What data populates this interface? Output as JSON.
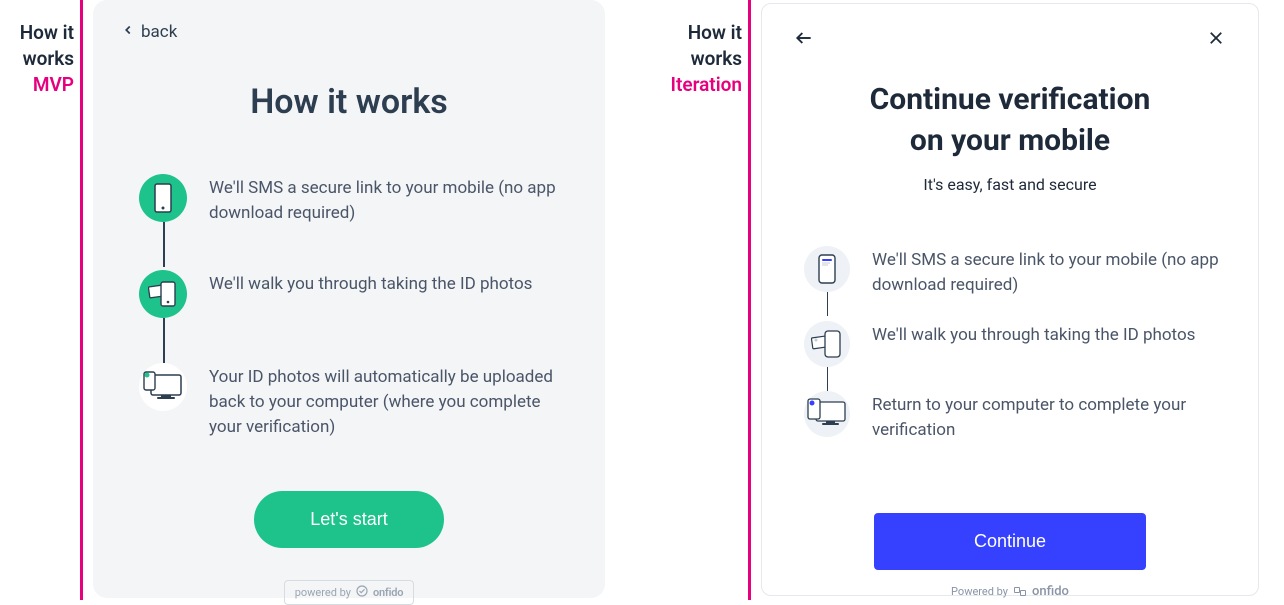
{
  "left": {
    "label_title": "How it works",
    "label_tag": "MVP",
    "back_label": "back",
    "heading": "How it works",
    "steps": [
      "We'll SMS a secure link to your mobile (no app download required)",
      "We'll walk you through taking the ID photos",
      "Your ID photos will automatically be uploaded back to your computer (where you complete your verification)"
    ],
    "cta": "Let's start",
    "powered_prefix": "powered by",
    "brand": "onfido"
  },
  "right": {
    "label_title": "How it works",
    "label_tag": "Iteration",
    "heading_l1": "Continue verification",
    "heading_l2": "on your mobile",
    "subtitle": "It's easy, fast and secure",
    "steps": [
      "We'll SMS a secure link to your mobile (no app download required)",
      "We'll walk you through taking the ID photos",
      "Return to your computer to complete your verification"
    ],
    "cta": "Continue",
    "powered_prefix": "Powered by",
    "brand": "onfido"
  }
}
